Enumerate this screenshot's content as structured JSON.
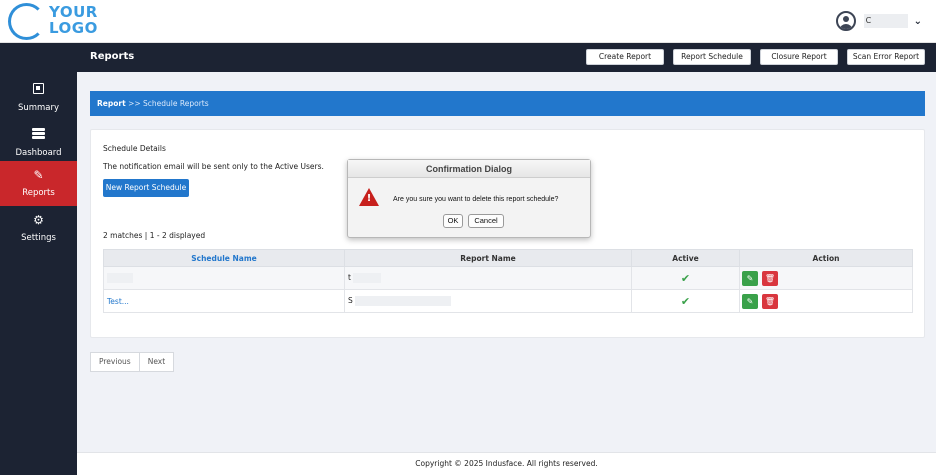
{
  "logo": {
    "line1": "YOUR",
    "line2": "LOGO"
  },
  "user": {
    "name": "C"
  },
  "sidebar": {
    "items": [
      {
        "label": "Summary",
        "icon": "summary-icon"
      },
      {
        "label": "Dashboard",
        "icon": "dashboard-icon"
      },
      {
        "label": "Reports",
        "icon": "edit-icon",
        "active": true
      },
      {
        "label": "Settings",
        "icon": "gear-icon"
      }
    ]
  },
  "header": {
    "title": "Reports",
    "buttons": [
      "Create Report",
      "Report Schedule",
      "Closure Report",
      "Scan Error Report"
    ]
  },
  "breadcrumb": {
    "root": "Report",
    "sep": ">>",
    "current": "Schedule Reports"
  },
  "panel": {
    "title": "Schedule Details",
    "note": "The notification email will be sent only to the Active Users.",
    "new_button": "New Report Schedule",
    "matches": "2 matches | 1 - 2 displayed"
  },
  "table": {
    "headers": [
      "Schedule Name",
      "Report Name",
      "Active",
      "Action"
    ],
    "rows": [
      {
        "schedule": "",
        "report": "t",
        "active": "✔"
      },
      {
        "schedule": "Test...",
        "report": "S",
        "active": "✔"
      }
    ]
  },
  "pager": {
    "prev": "Previous",
    "next": "Next"
  },
  "footer": "Copyright © 2025 Indusface. All rights reserved.",
  "dialog": {
    "title": "Confirmation Dialog",
    "message": "Are you sure you want to delete this report schedule?",
    "ok": "OK",
    "cancel": "Cancel"
  },
  "colors": {
    "sidebar": "#1c2333",
    "active": "#c9272b",
    "accent": "#2277cc",
    "success": "#3aa14a",
    "danger": "#d9363e"
  }
}
